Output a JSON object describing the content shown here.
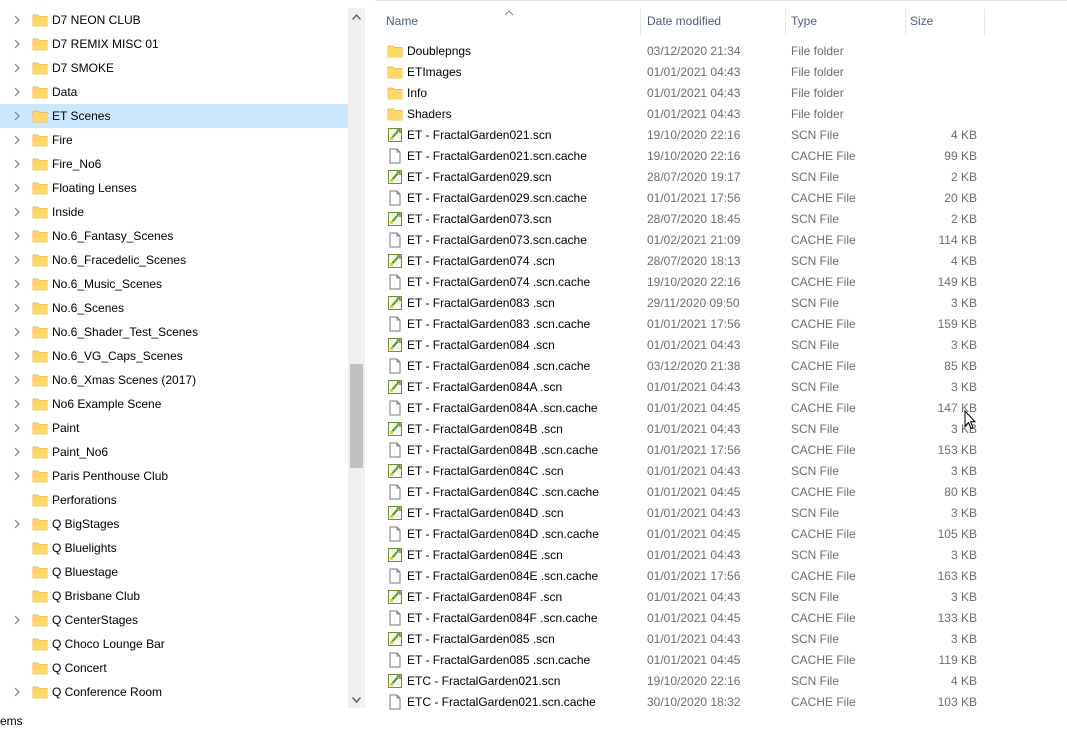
{
  "nav": {
    "items": [
      {
        "label": "D7 NEON CLUB",
        "expandable": true,
        "selected": false
      },
      {
        "label": "D7 REMIX MISC 01",
        "expandable": true,
        "selected": false
      },
      {
        "label": "D7 SMOKE",
        "expandable": true,
        "selected": false
      },
      {
        "label": "Data",
        "expandable": true,
        "selected": false
      },
      {
        "label": "ET Scenes",
        "expandable": true,
        "selected": true
      },
      {
        "label": "Fire",
        "expandable": true,
        "selected": false
      },
      {
        "label": "Fire_No6",
        "expandable": true,
        "selected": false
      },
      {
        "label": "Floating Lenses",
        "expandable": true,
        "selected": false
      },
      {
        "label": "Inside",
        "expandable": true,
        "selected": false
      },
      {
        "label": "No.6_Fantasy_Scenes",
        "expandable": true,
        "selected": false
      },
      {
        "label": "No.6_Fracedelic_Scenes",
        "expandable": true,
        "selected": false
      },
      {
        "label": "No.6_Music_Scenes",
        "expandable": true,
        "selected": false
      },
      {
        "label": "No.6_Scenes",
        "expandable": true,
        "selected": false
      },
      {
        "label": "No.6_Shader_Test_Scenes",
        "expandable": true,
        "selected": false
      },
      {
        "label": "No.6_VG_Caps_Scenes",
        "expandable": true,
        "selected": false
      },
      {
        "label": "No.6_Xmas Scenes (2017)",
        "expandable": true,
        "selected": false
      },
      {
        "label": "No6 Example Scene",
        "expandable": true,
        "selected": false
      },
      {
        "label": "Paint",
        "expandable": true,
        "selected": false
      },
      {
        "label": "Paint_No6",
        "expandable": true,
        "selected": false
      },
      {
        "label": "Paris Penthouse Club",
        "expandable": true,
        "selected": false
      },
      {
        "label": "Perforations",
        "expandable": false,
        "selected": false
      },
      {
        "label": "Q BigStages",
        "expandable": true,
        "selected": false
      },
      {
        "label": "Q Bluelights",
        "expandable": false,
        "selected": false
      },
      {
        "label": "Q Bluestage",
        "expandable": false,
        "selected": false
      },
      {
        "label": "Q Brisbane Club",
        "expandable": false,
        "selected": false
      },
      {
        "label": "Q CenterStages",
        "expandable": true,
        "selected": false
      },
      {
        "label": "Q Choco Lounge Bar",
        "expandable": false,
        "selected": false
      },
      {
        "label": "Q Concert",
        "expandable": false,
        "selected": false
      },
      {
        "label": "Q Conference Room",
        "expandable": true,
        "selected": false
      }
    ]
  },
  "columns": {
    "name": "Name",
    "date": "Date modified",
    "type": "Type",
    "size": "Size"
  },
  "files": [
    {
      "name": "Doublepngs",
      "date": "03/12/2020 21:34",
      "type": "File folder",
      "size": "",
      "icon": "folder-icon"
    },
    {
      "name": "ETImages",
      "date": "01/01/2021 04:43",
      "type": "File folder",
      "size": "",
      "icon": "folder-icon"
    },
    {
      "name": "Info",
      "date": "01/01/2021 04:43",
      "type": "File folder",
      "size": "",
      "icon": "folder-icon"
    },
    {
      "name": "Shaders",
      "date": "01/01/2021 04:43",
      "type": "File folder",
      "size": "",
      "icon": "folder-icon"
    },
    {
      "name": "ET - FractalGarden021.scn",
      "date": "19/10/2020 22:16",
      "type": "SCN File",
      "size": "4 KB",
      "icon": "scn-file-icon"
    },
    {
      "name": "ET - FractalGarden021.scn.cache",
      "date": "19/10/2020 22:16",
      "type": "CACHE File",
      "size": "99 KB",
      "icon": "blank-file-icon"
    },
    {
      "name": "ET - FractalGarden029.scn",
      "date": "28/07/2020 19:17",
      "type": "SCN File",
      "size": "2 KB",
      "icon": "scn-file-icon"
    },
    {
      "name": "ET - FractalGarden029.scn.cache",
      "date": "01/01/2021 17:56",
      "type": "CACHE File",
      "size": "20 KB",
      "icon": "blank-file-icon"
    },
    {
      "name": "ET - FractalGarden073.scn",
      "date": "28/07/2020 18:45",
      "type": "SCN File",
      "size": "2 KB",
      "icon": "scn-file-icon"
    },
    {
      "name": "ET - FractalGarden073.scn.cache",
      "date": "01/02/2021 21:09",
      "type": "CACHE File",
      "size": "114 KB",
      "icon": "blank-file-icon"
    },
    {
      "name": "ET - FractalGarden074 .scn",
      "date": "28/07/2020 18:13",
      "type": "SCN File",
      "size": "4 KB",
      "icon": "scn-file-icon"
    },
    {
      "name": "ET - FractalGarden074 .scn.cache",
      "date": "19/10/2020 22:16",
      "type": "CACHE File",
      "size": "149 KB",
      "icon": "blank-file-icon"
    },
    {
      "name": "ET - FractalGarden083 .scn",
      "date": "29/11/2020 09:50",
      "type": "SCN File",
      "size": "3 KB",
      "icon": "scn-file-icon"
    },
    {
      "name": "ET - FractalGarden083 .scn.cache",
      "date": "01/01/2021 17:56",
      "type": "CACHE File",
      "size": "159 KB",
      "icon": "blank-file-icon"
    },
    {
      "name": "ET - FractalGarden084 .scn",
      "date": "01/01/2021 04:43",
      "type": "SCN File",
      "size": "3 KB",
      "icon": "scn-file-icon"
    },
    {
      "name": "ET - FractalGarden084 .scn.cache",
      "date": "03/12/2020 21:38",
      "type": "CACHE File",
      "size": "85 KB",
      "icon": "blank-file-icon"
    },
    {
      "name": "ET - FractalGarden084A .scn",
      "date": "01/01/2021 04:43",
      "type": "SCN File",
      "size": "3 KB",
      "icon": "scn-file-icon"
    },
    {
      "name": "ET - FractalGarden084A .scn.cache",
      "date": "01/01/2021 04:45",
      "type": "CACHE File",
      "size": "147 KB",
      "icon": "blank-file-icon"
    },
    {
      "name": "ET - FractalGarden084B .scn",
      "date": "01/01/2021 04:43",
      "type": "SCN File",
      "size": "3 KB",
      "icon": "scn-file-icon"
    },
    {
      "name": "ET - FractalGarden084B .scn.cache",
      "date": "01/01/2021 17:56",
      "type": "CACHE File",
      "size": "153 KB",
      "icon": "blank-file-icon"
    },
    {
      "name": "ET - FractalGarden084C .scn",
      "date": "01/01/2021 04:43",
      "type": "SCN File",
      "size": "3 KB",
      "icon": "scn-file-icon"
    },
    {
      "name": "ET - FractalGarden084C .scn.cache",
      "date": "01/01/2021 04:45",
      "type": "CACHE File",
      "size": "80 KB",
      "icon": "blank-file-icon"
    },
    {
      "name": "ET - FractalGarden084D .scn",
      "date": "01/01/2021 04:43",
      "type": "SCN File",
      "size": "3 KB",
      "icon": "scn-file-icon"
    },
    {
      "name": "ET - FractalGarden084D .scn.cache",
      "date": "01/01/2021 04:45",
      "type": "CACHE File",
      "size": "105 KB",
      "icon": "blank-file-icon"
    },
    {
      "name": "ET - FractalGarden084E .scn",
      "date": "01/01/2021 04:43",
      "type": "SCN File",
      "size": "3 KB",
      "icon": "scn-file-icon"
    },
    {
      "name": "ET - FractalGarden084E .scn.cache",
      "date": "01/01/2021 17:56",
      "type": "CACHE File",
      "size": "163 KB",
      "icon": "blank-file-icon"
    },
    {
      "name": "ET - FractalGarden084F .scn",
      "date": "01/01/2021 04:43",
      "type": "SCN File",
      "size": "3 KB",
      "icon": "scn-file-icon"
    },
    {
      "name": "ET - FractalGarden084F .scn.cache",
      "date": "01/01/2021 04:45",
      "type": "CACHE File",
      "size": "133 KB",
      "icon": "blank-file-icon"
    },
    {
      "name": "ET - FractalGarden085 .scn",
      "date": "01/01/2021 04:43",
      "type": "SCN File",
      "size": "3 KB",
      "icon": "scn-file-icon"
    },
    {
      "name": "ET - FractalGarden085 .scn.cache",
      "date": "01/01/2021 04:45",
      "type": "CACHE File",
      "size": "119 KB",
      "icon": "blank-file-icon"
    },
    {
      "name": "ETC - FractalGarden021.scn",
      "date": "19/10/2020 22:16",
      "type": "SCN File",
      "size": "4 KB",
      "icon": "scn-file-icon"
    },
    {
      "name": "ETC - FractalGarden021.scn.cache",
      "date": "30/10/2020 18:32",
      "type": "CACHE File",
      "size": "103 KB",
      "icon": "blank-file-icon"
    }
  ],
  "status": {
    "text": "ems"
  },
  "colors": {
    "selection": "#cce8ff",
    "folder": "#ffd766",
    "header_text": "#4c607a",
    "muted_text": "#6d6d6d"
  }
}
